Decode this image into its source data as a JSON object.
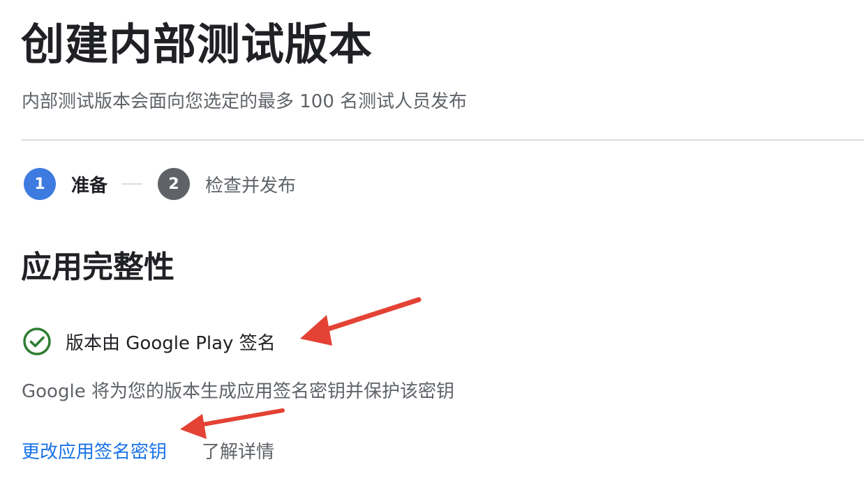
{
  "header": {
    "title": "创建内部测试版本",
    "subtitle": "内部测试版本会面向您选定的最多 100 名测试人员发布"
  },
  "stepper": {
    "steps": [
      {
        "number": "1",
        "label": "准备",
        "state": "active"
      },
      {
        "number": "2",
        "label": "检查并发布",
        "state": "inactive"
      }
    ]
  },
  "app_integrity": {
    "heading": "应用完整性",
    "status": {
      "icon": "check-circle-icon",
      "text": "版本由 Google Play 签名"
    },
    "description": "Google 将为您的版本生成应用签名密钥并保护该密钥",
    "links": {
      "change_key": "更改应用签名密钥",
      "learn_more": "了解详情"
    }
  },
  "colors": {
    "accent": "#3e7be0",
    "link": "#1a73e8",
    "success": "#2e7d32",
    "annotation_arrow": "#e34234"
  }
}
